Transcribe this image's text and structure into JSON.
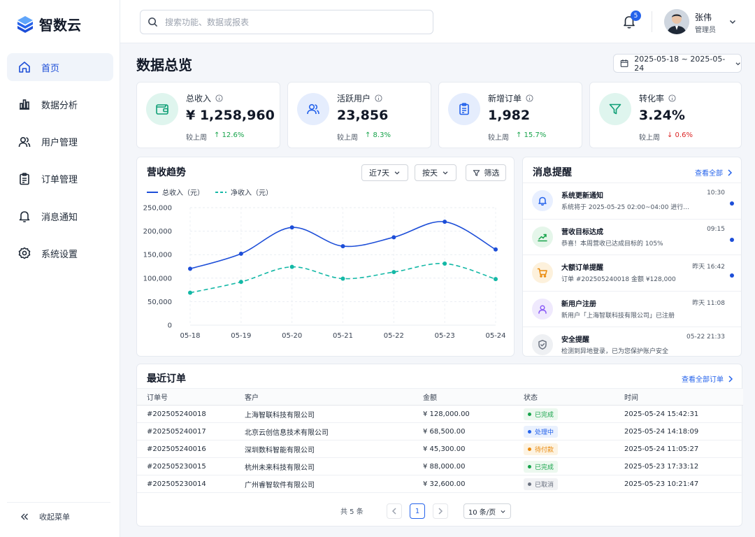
{
  "app": {
    "name": "智数云"
  },
  "sidebar": {
    "items": [
      {
        "label": "首页",
        "active": true
      },
      {
        "label": "数据分析"
      },
      {
        "label": "用户管理"
      },
      {
        "label": "订单管理"
      },
      {
        "label": "消息通知"
      },
      {
        "label": "系统设置"
      }
    ],
    "collapse_label": "收起菜单"
  },
  "header": {
    "search_placeholder": "搜索功能、数据或报表",
    "notification_count": "5",
    "user": {
      "name": "张伟",
      "role": "管理员"
    }
  },
  "page": {
    "title": "数据总览",
    "date_range": "2025-05-18 ~ 2025-05-24"
  },
  "kpis": [
    {
      "label": "总收入",
      "value": "¥ 1,258,960",
      "compare_label": "较上周",
      "change": "↑ 12.6%",
      "trend": "up",
      "icon": "wallet-icon"
    },
    {
      "label": "活跃用户",
      "value": "23,856",
      "compare_label": "较上周",
      "change": "↑ 8.3%",
      "trend": "up",
      "icon": "users-icon"
    },
    {
      "label": "新增订单",
      "value": "1,982",
      "compare_label": "较上周",
      "change": "↑ 15.7%",
      "trend": "up",
      "icon": "clipboard-icon"
    },
    {
      "label": "转化率",
      "value": "3.24%",
      "compare_label": "较上周",
      "change": "↓ 0.6%",
      "trend": "down",
      "icon": "funnel-icon"
    }
  ],
  "revenue_panel": {
    "title": "营收趋势",
    "range_select": "近7天",
    "granularity_select": "按天",
    "filter_label": "筛选"
  },
  "chart_data": {
    "type": "line",
    "title": "营收趋势",
    "x": [
      "05-18",
      "05-19",
      "05-20",
      "05-21",
      "05-22",
      "05-23",
      "05-24"
    ],
    "series": [
      {
        "name": "总收入（元）",
        "color": "#1d4ed8",
        "style": "solid",
        "values": [
          120000,
          152000,
          208000,
          168000,
          187000,
          220000,
          161000
        ]
      },
      {
        "name": "净收入（元）",
        "color": "#14b8a6",
        "style": "dashed",
        "values": [
          69000,
          92000,
          124000,
          99000,
          113000,
          131000,
          98000
        ]
      }
    ],
    "y_ticks": [
      "250,000",
      "200,000",
      "150,000",
      "100,000",
      "50,000",
      "0"
    ],
    "ylim": [
      0,
      250000
    ],
    "grid": true,
    "legend": "top-left"
  },
  "messages": {
    "title": "消息提醒",
    "view_all": "查看全部",
    "items": [
      {
        "title": "系统更新通知",
        "desc": "系统将于 2025-05-25 02:00~04:00 进行...",
        "time": "10:30",
        "unread": true,
        "icon": "bell-icon",
        "color": "#2563eb",
        "bg": "#e8efff"
      },
      {
        "title": "营收目标达成",
        "desc": "恭喜！本周营收已达成目标的 105%",
        "time": "09:15",
        "unread": true,
        "icon": "trend-up-icon",
        "color": "#16a34a",
        "bg": "#e5f6ea"
      },
      {
        "title": "大额订单提醒",
        "desc": "订单 #202505240018 金额 ¥128,000",
        "time": "昨天 16:42",
        "unread": true,
        "icon": "cart-icon",
        "color": "#ea8a0c",
        "bg": "#fdf1dc"
      },
      {
        "title": "新用户注册",
        "desc": "新用户「上海智联科技有限公司」已注册",
        "time": "昨天 11:08",
        "unread": false,
        "icon": "user-icon",
        "color": "#8b5cf6",
        "bg": "#efe9fd"
      },
      {
        "title": "安全提醒",
        "desc": "检测到异地登录，已为您保护账户安全",
        "time": "05-22 21:33",
        "unread": false,
        "icon": "shield-icon",
        "color": "#6b7280",
        "bg": "#eef0f3"
      }
    ]
  },
  "orders": {
    "title": "最近订单",
    "view_all": "查看全部订单",
    "columns": [
      "订单号",
      "客户",
      "金额",
      "状态",
      "时间"
    ],
    "rows": [
      {
        "id": "#202505240018",
        "customer": "上海智联科技有限公司",
        "amount": "¥ 128,000.00",
        "status": "已完成",
        "status_color": "#16a34a",
        "status_bg": "#ecf8ef",
        "time": "2025-05-24 15:42:31"
      },
      {
        "id": "#202505240017",
        "customer": "北京云创信息技术有限公司",
        "amount": "¥ 68,500.00",
        "status": "处理中",
        "status_color": "#2563eb",
        "status_bg": "#eaf1fe",
        "time": "2025-05-24 14:18:09"
      },
      {
        "id": "#202505240016",
        "customer": "深圳数科智能有限公司",
        "amount": "¥ 45,300.00",
        "status": "待付款",
        "status_color": "#ea8a0c",
        "status_bg": "#fdf3e2",
        "time": "2025-05-24 11:05:27"
      },
      {
        "id": "#202505230015",
        "customer": "杭州未来科技有限公司",
        "amount": "¥ 88,000.00",
        "status": "已完成",
        "status_color": "#16a34a",
        "status_bg": "#ecf8ef",
        "time": "2025-05-23 17:33:12"
      },
      {
        "id": "#202505230014",
        "customer": "广州睿智软件有限公司",
        "amount": "¥ 32,600.00",
        "status": "已取消",
        "status_color": "#6b7280",
        "status_bg": "#f1f2f4",
        "time": "2025-05-23 10:21:47"
      }
    ],
    "pagination": {
      "total": "共 5 条",
      "page": "1",
      "page_size": "10 条/页"
    }
  }
}
